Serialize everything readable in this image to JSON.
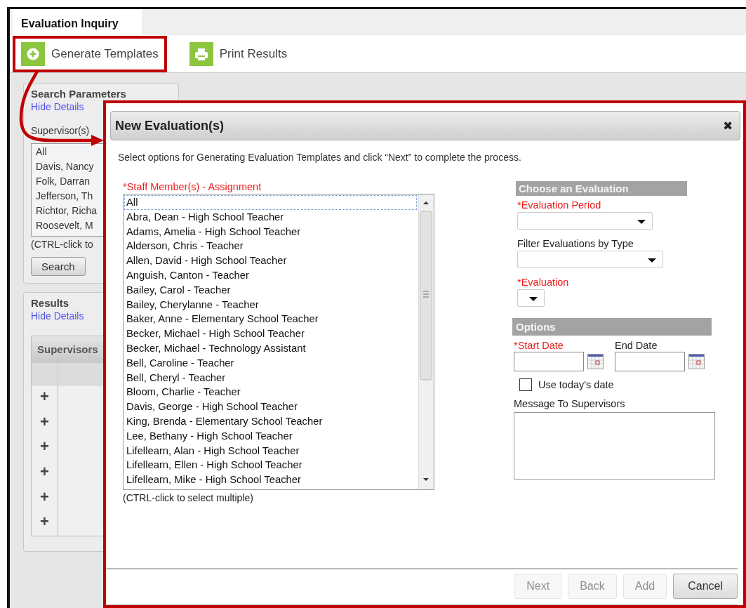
{
  "tab": {
    "label": "Evaluation Inquiry",
    "selected": true
  },
  "toolbar": [
    {
      "label": "Generate Templates",
      "kind": "add",
      "highlighted": true
    },
    {
      "label": "Print Results",
      "kind": "print",
      "highlighted": false
    }
  ],
  "search_parameters": {
    "title": "Search Parameters",
    "hide_link": "Hide Details",
    "supervisors_label": "Supervisor(s)",
    "supervisors": [
      "All",
      "Davis, Nancy",
      "Folk, Darran",
      "Jefferson, Th",
      "Richtor, Richa",
      "Roosevelt, M"
    ],
    "hint": "(CTRL-click to",
    "button": "Search"
  },
  "results": {
    "title": "Results",
    "hide_link": "Hide Details",
    "column_1": "Supervisors",
    "rows": [
      "+",
      "+",
      "+",
      "+",
      "+",
      "+"
    ]
  },
  "dialog": {
    "title": "New Evaluation(s)",
    "highlighted": true,
    "close": "✖",
    "instructions": "Select options for Generating Evaluation Templates and click “Next” to complete the process.",
    "staff": {
      "label": "*Staff Member(s) - Assignment",
      "required": true,
      "hint": "(CTRL-click to select multiple)",
      "items": [
        {
          "label": "All",
          "focused": true,
          "selected": false
        },
        {
          "label": "Abra, Dean - High School Teacher",
          "focused": false,
          "selected": false
        },
        {
          "label": "Adams, Amelia - High School Teacher",
          "focused": false,
          "selected": false
        },
        {
          "label": "Alderson, Chris - Teacher",
          "focused": false,
          "selected": false
        },
        {
          "label": "Allen, David - High School Teacher",
          "focused": false,
          "selected": false
        },
        {
          "label": "Anguish, Canton - Teacher",
          "focused": false,
          "selected": false
        },
        {
          "label": "Bailey, Carol - Teacher",
          "focused": false,
          "selected": false
        },
        {
          "label": "Bailey, Cherylanne - Teacher",
          "focused": false,
          "selected": false
        },
        {
          "label": "Baker, Anne - Elementary School Teacher",
          "focused": false,
          "selected": false
        },
        {
          "label": "Becker, Michael - High School Teacher",
          "focused": false,
          "selected": false
        },
        {
          "label": "Becker, Michael - Technology Assistant",
          "focused": false,
          "selected": false
        },
        {
          "label": "Bell, Caroline - Teacher",
          "focused": false,
          "selected": false
        },
        {
          "label": "Bell, Cheryl - Teacher",
          "focused": false,
          "selected": false
        },
        {
          "label": "Bloom, Charlie - Teacher",
          "focused": false,
          "selected": false
        },
        {
          "label": "Davis, George - High School Teacher",
          "focused": false,
          "selected": false
        },
        {
          "label": "King, Brenda - Elementary School Teacher",
          "focused": false,
          "selected": false
        },
        {
          "label": "Lee, Bethany - High School Teacher",
          "focused": false,
          "selected": false
        },
        {
          "label": "Lifellearn, Alan - High School Teacher",
          "focused": false,
          "selected": false
        },
        {
          "label": "Lifellearn, Ellen - High School Teacher",
          "focused": false,
          "selected": false
        },
        {
          "label": "Lifellearn, Mike - High School Teacher",
          "focused": false,
          "selected": false
        }
      ]
    },
    "choose_section": "Choose an Evaluation",
    "evaluation_fields": [
      {
        "label": "*Evaluation Period",
        "required": true
      },
      {
        "label": "Filter Evaluations by Type",
        "required": false
      },
      {
        "label": "*Evaluation",
        "required": true
      }
    ],
    "options_section": "Options",
    "dates": [
      {
        "label": "*Start Date",
        "required": true
      },
      {
        "label": "End Date",
        "required": false
      }
    ],
    "use_today": {
      "label": "Use today's date",
      "checked": false
    },
    "message_label": "Message To Supervisors",
    "buttons": [
      {
        "label": "Next",
        "disabled": true
      },
      {
        "label": "Back",
        "disabled": true
      },
      {
        "label": "Add",
        "disabled": true
      },
      {
        "label": "Cancel",
        "disabled": false
      }
    ]
  }
}
